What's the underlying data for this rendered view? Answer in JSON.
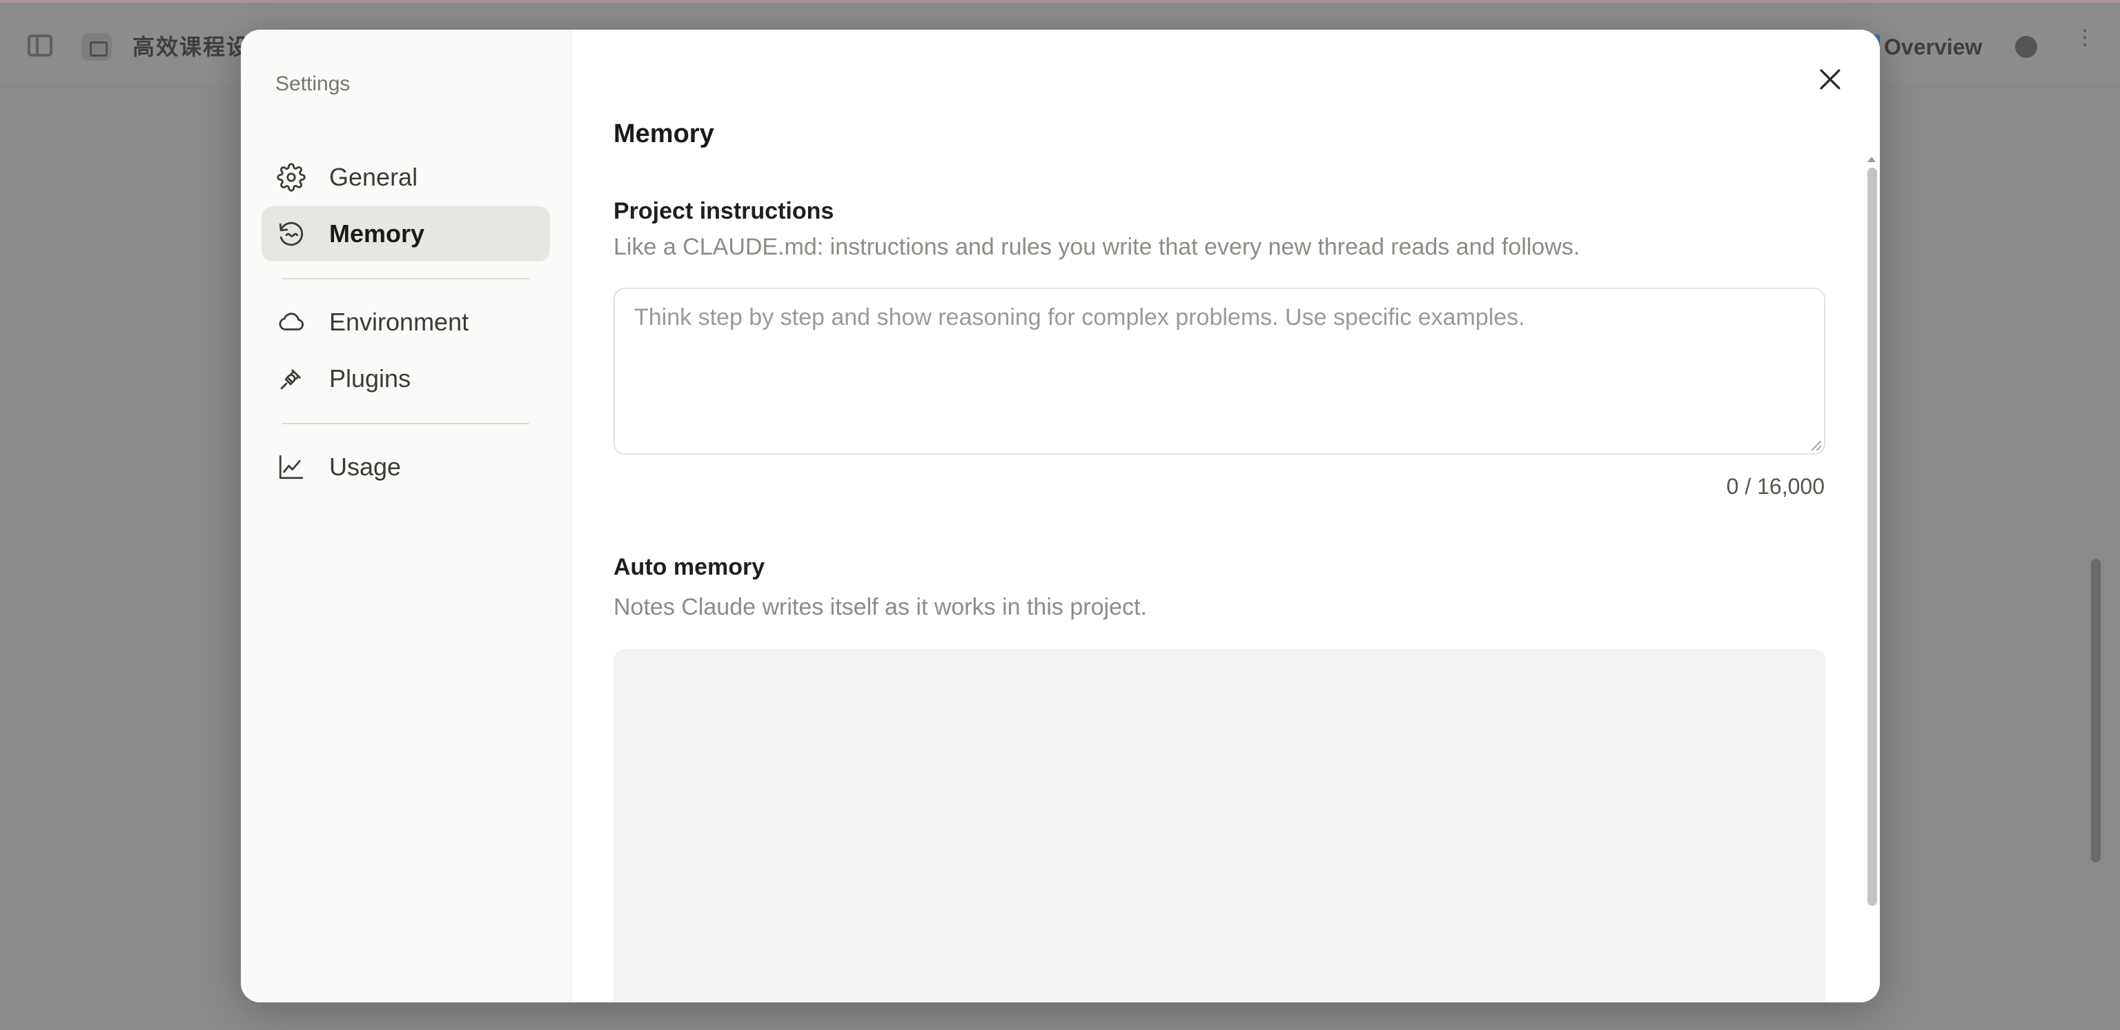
{
  "background": {
    "title": "高效课程设计",
    "overview_label": "Overview"
  },
  "modal": {
    "sidebar": {
      "heading": "Settings",
      "items": [
        {
          "label": "General",
          "icon": "gear-icon"
        },
        {
          "label": "Memory",
          "icon": "memory-icon",
          "active": true
        },
        {
          "label": "Environment",
          "icon": "cloud-icon"
        },
        {
          "label": "Plugins",
          "icon": "plug-icon"
        },
        {
          "label": "Usage",
          "icon": "chart-icon"
        }
      ]
    },
    "main": {
      "title": "Memory",
      "project_instructions": {
        "title": "Project instructions",
        "description": "Like a CLAUDE.md: instructions and rules you write that every new thread reads and follows.",
        "placeholder": "Think step by step and show reasoning for complex problems. Use specific examples.",
        "value": "",
        "char_count": "0 / 16,000"
      },
      "auto_memory": {
        "title": "Auto memory",
        "description": "Notes Claude writes itself as it works in this project."
      }
    }
  },
  "colors": {
    "overlay": "#8a8a8a",
    "modal_bg": "#ffffff",
    "sidebar_bg": "#fafaf8",
    "active_item_bg": "#e6e6e3",
    "muted_text": "#8c8c86"
  }
}
